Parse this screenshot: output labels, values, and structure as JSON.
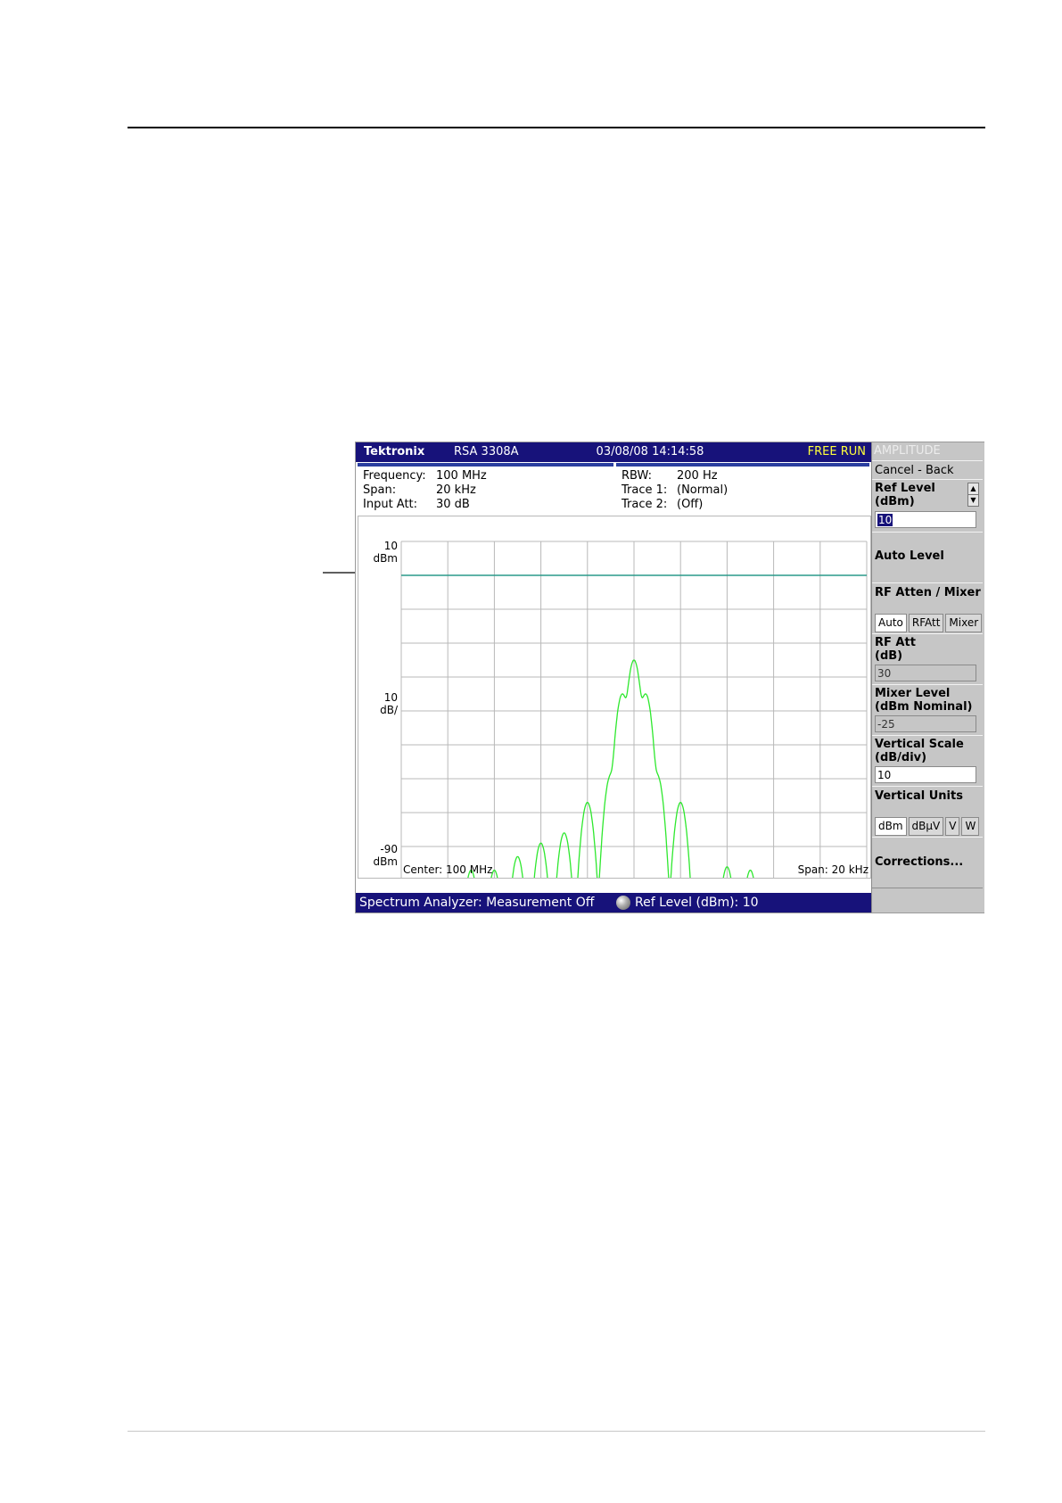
{
  "instrument": {
    "brand": "Tektronix",
    "model": "RSA 3308A",
    "datetime": "03/08/08 14:14:58",
    "run_state": "FREE RUN"
  },
  "settings": {
    "frequency_label": "Frequency:",
    "frequency_value": "100 MHz",
    "span_label": "Span:",
    "span_value": "20 kHz",
    "input_att_label": "Input Att:",
    "input_att_value": "30 dB",
    "rbw_label": "RBW:",
    "rbw_value": "200 Hz",
    "trace1_label": "Trace 1:",
    "trace1_value": "(Normal)",
    "trace2_label": "Trace 2:",
    "trace2_value": "(Off)"
  },
  "plot": {
    "top_value": "10",
    "top_unit": "dBm",
    "scale_value": "10",
    "scale_unit": "dB/",
    "bottom_value": "-90",
    "bottom_unit": "dBm",
    "center_label": "Center: 100 MHz",
    "span_label": "Span: 20 kHz"
  },
  "status": {
    "message": "Spectrum Analyzer: Measurement Off",
    "knob_function": "Ref Level (dBm): 10"
  },
  "menu": {
    "title": "AMPLITUDE",
    "cancel_back": "Cancel - Back",
    "ref_level_label": "Ref Level",
    "ref_level_unit": "(dBm)",
    "ref_level_value": "10",
    "auto_level": "Auto Level",
    "rf_atten_mixer": "RF Atten / Mixer",
    "atten_options": [
      "Auto",
      "RFAtt",
      "Mixer"
    ],
    "rf_att_label": "RF Att",
    "rf_att_unit": "(dB)",
    "rf_att_value": "30",
    "mixer_level_label": "Mixer Level",
    "mixer_level_unit": "(dBm Nominal)",
    "mixer_level_value": "-25",
    "vertical_scale_label": "Vertical Scale",
    "vertical_scale_unit": "(dB/div)",
    "vertical_scale_value": "10",
    "vertical_units_label": "Vertical Units",
    "unit_options": [
      "dBm",
      "dBμV",
      "V",
      "W"
    ],
    "corrections": "Corrections..."
  },
  "colors": {
    "titlebar": "#17127a",
    "run_state": "#ffff3c",
    "trace": "#2ee82e",
    "ref_line": "#2a9a8a",
    "grid": "#b8b8b8"
  },
  "chart_data": {
    "type": "line",
    "x_range_khz": [
      -10,
      10
    ],
    "ylim_dbm": [
      -90,
      10
    ],
    "reference_level_dbm": 10,
    "reference_line_dbm": 0,
    "peaks": [
      {
        "offset_khz": -7.0,
        "level_dbm": -87
      },
      {
        "offset_khz": -6.0,
        "level_dbm": -87
      },
      {
        "offset_khz": -5.0,
        "level_dbm": -83
      },
      {
        "offset_khz": -4.0,
        "level_dbm": -79
      },
      {
        "offset_khz": -3.0,
        "level_dbm": -76
      },
      {
        "offset_khz": -2.0,
        "level_dbm": -67
      },
      {
        "offset_khz": -1.0,
        "level_dbm": -59
      },
      {
        "offset_khz": -0.5,
        "level_dbm": -35
      },
      {
        "offset_khz": 0.0,
        "level_dbm": -25
      },
      {
        "offset_khz": 0.5,
        "level_dbm": -35
      },
      {
        "offset_khz": 1.0,
        "level_dbm": -59
      },
      {
        "offset_khz": 2.0,
        "level_dbm": -67
      },
      {
        "offset_khz": 4.0,
        "level_dbm": -86
      },
      {
        "offset_khz": 5.0,
        "level_dbm": -87
      }
    ]
  }
}
